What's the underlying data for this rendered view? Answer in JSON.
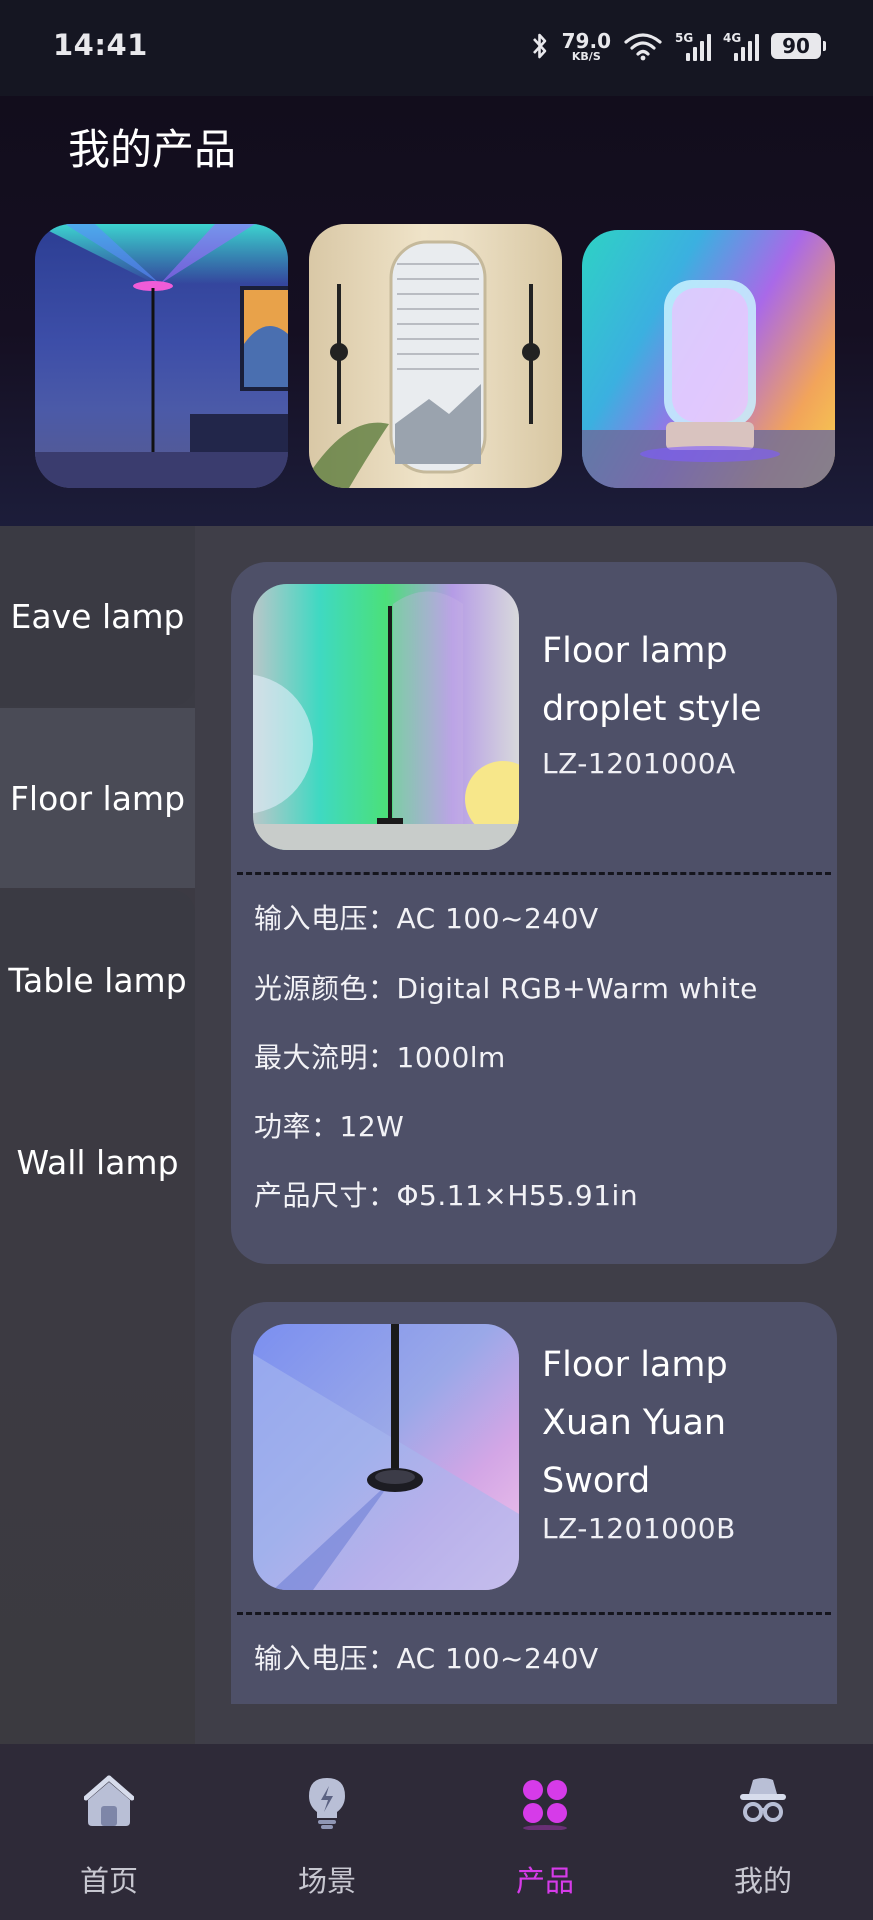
{
  "status_bar": {
    "time": "14:41",
    "net_speed": "79.0",
    "net_unit": "KB/S",
    "signal1": "5G",
    "signal2": "4G",
    "battery": "90",
    "icons": [
      "bluetooth-icon",
      "wifi-icon",
      "signal-icon",
      "battery-icon"
    ]
  },
  "header": {
    "title": "我的产品"
  },
  "sidebar": {
    "items": [
      {
        "label": "Eave lamp"
      },
      {
        "label": "Floor lamp"
      },
      {
        "label": "Table lamp"
      },
      {
        "label": "Wall lamp"
      }
    ],
    "selected": "Floor lamp"
  },
  "products": [
    {
      "name": "Floor lamp droplet style",
      "model": "LZ-1201000A",
      "specs": [
        "输入电压：AC 100~240V",
        "光源颜色：Digital RGB+Warm white",
        "最大流明：1000lm",
        "功率：12W",
        "产品尺寸：Φ5.11×H55.91in"
      ]
    },
    {
      "name": "Floor lamp Xuan Yuan Sword",
      "model": "LZ-1201000B",
      "specs": [
        "输入电压：AC 100~240V"
      ]
    }
  ],
  "bottom_nav": {
    "items": [
      {
        "label": "首页",
        "icon": "home-icon"
      },
      {
        "label": "场景",
        "icon": "bulb-icon"
      },
      {
        "label": "产品",
        "icon": "products-icon"
      },
      {
        "label": "我的",
        "icon": "profile-icon"
      }
    ],
    "active": "产品",
    "active_color": "#d63be9",
    "inactive_color": "#c7c7d0"
  }
}
